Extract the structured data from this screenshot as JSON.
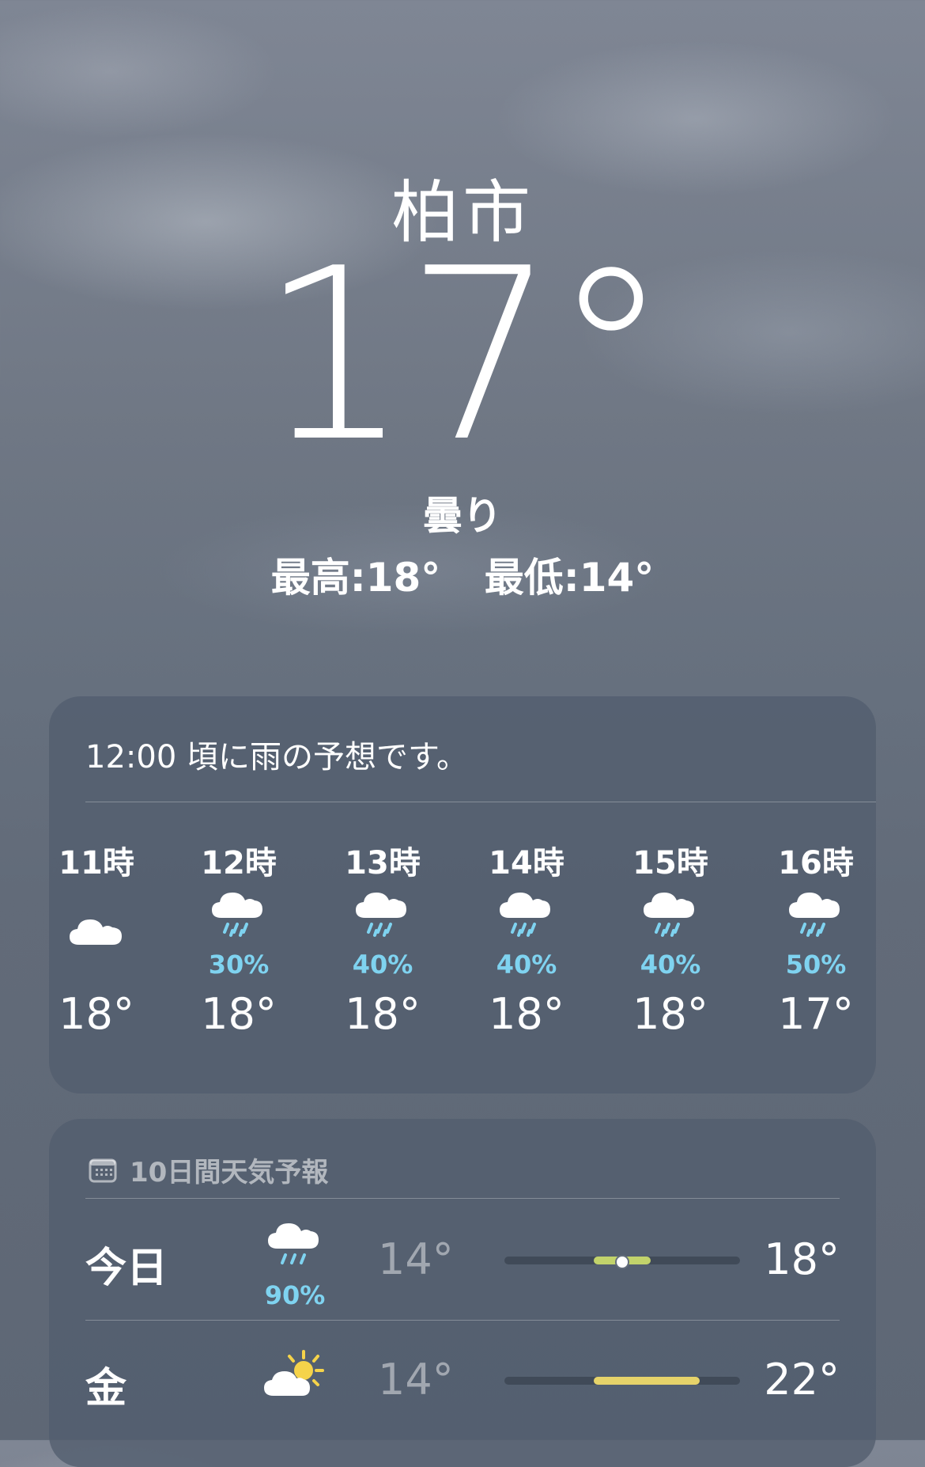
{
  "current": {
    "city": "柏市",
    "temperature": "17°",
    "condition": "曇り",
    "high": "最高:18°",
    "low": "最低:14°"
  },
  "hourly": {
    "summary": "12:00 頃に雨の予想です。",
    "items": [
      {
        "time": "11時",
        "icon": "cloud-icon",
        "precip": "",
        "temp": "18°"
      },
      {
        "time": "12時",
        "icon": "cloud-rain-icon",
        "precip": "30%",
        "temp": "18°"
      },
      {
        "time": "13時",
        "icon": "cloud-rain-icon",
        "precip": "40%",
        "temp": "18°"
      },
      {
        "time": "14時",
        "icon": "cloud-rain-icon",
        "precip": "40%",
        "temp": "18°"
      },
      {
        "time": "15時",
        "icon": "cloud-rain-icon",
        "precip": "40%",
        "temp": "18°"
      },
      {
        "time": "16時",
        "icon": "cloud-rain-icon",
        "precip": "50%",
        "temp": "17°"
      }
    ]
  },
  "daily": {
    "title": "10日間天気予報",
    "title_icon": "calendar-icon",
    "rows": [
      {
        "day": "今日",
        "icon": "cloud-rain-icon",
        "precip": "90%",
        "low": "14°",
        "high": "18°",
        "range_start": 0.38,
        "range_end": 0.62,
        "current_marker": 0.5,
        "fill_color": "#c2d36b"
      },
      {
        "day": "金",
        "icon": "sun-cloud-icon",
        "precip": "",
        "low": "14°",
        "high": "22°",
        "range_start": 0.38,
        "range_end": 0.83,
        "fill_color": "#e6d36a"
      }
    ]
  },
  "colors": {
    "precip": "#7fd3f0",
    "card_bg": "#525d6e",
    "sun": "#f5d34a"
  }
}
